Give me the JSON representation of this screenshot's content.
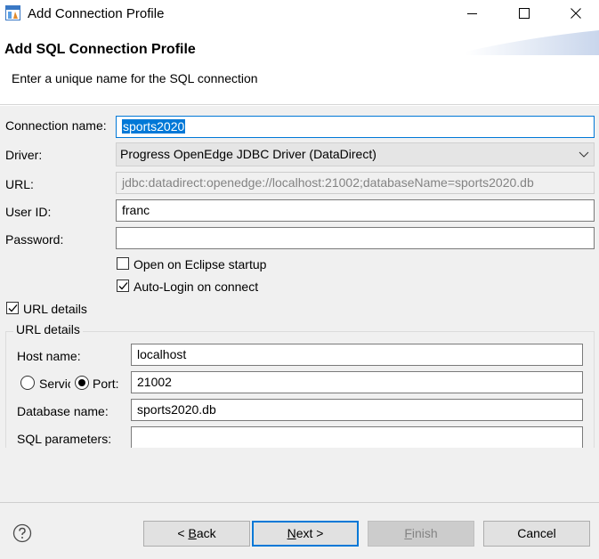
{
  "window": {
    "title": "Add Connection Profile",
    "icon": "app-icon",
    "controls": {
      "minimize": "minimize-icon",
      "maximize": "maximize-icon",
      "close": "close-icon"
    }
  },
  "banner": {
    "title": "Add SQL Connection Profile",
    "message": "Enter a unique name for the SQL connection"
  },
  "form": {
    "connection_name": {
      "label": "Connection name:",
      "value": "sports2020"
    },
    "driver": {
      "label": "Driver:",
      "value": "Progress OpenEdge JDBC Driver (DataDirect)"
    },
    "url": {
      "label": "URL:",
      "value": "jdbc:datadirect:openedge://localhost:21002;databaseName=sports2020.db"
    },
    "user_id": {
      "label": "User ID:",
      "value": "franc"
    },
    "password": {
      "label": "Password:",
      "value": ""
    },
    "open_on_startup": {
      "label": "Open on Eclipse startup",
      "checked": false
    },
    "auto_login": {
      "label": "Auto-Login on connect",
      "checked": true
    },
    "url_details_toggle": {
      "label": "URL details",
      "checked": true
    }
  },
  "url_details": {
    "group_label": "URL details",
    "host_name": {
      "label": "Host name:",
      "value": "localhost"
    },
    "service_radio": {
      "label": "Servic",
      "selected": false
    },
    "port_radio": {
      "label": "Port:",
      "selected": true
    },
    "port": {
      "value": "21002"
    },
    "database_name": {
      "label": "Database name:",
      "value": "sports2020.db"
    },
    "sql_parameters": {
      "label": "SQL parameters:",
      "value": ""
    }
  },
  "footer": {
    "help_icon": "help-icon",
    "back": {
      "prefix": "< ",
      "mnemonic": "B",
      "rest": "ack"
    },
    "next": {
      "mnemonic": "N",
      "rest": "ext >"
    },
    "finish": {
      "mnemonic": "F",
      "rest": "inish"
    },
    "cancel": "Cancel"
  },
  "colors": {
    "accent": "#0078d7",
    "panel": "#f0f0f0",
    "button": "#e1e1e1",
    "disabled_text": "#838383"
  }
}
